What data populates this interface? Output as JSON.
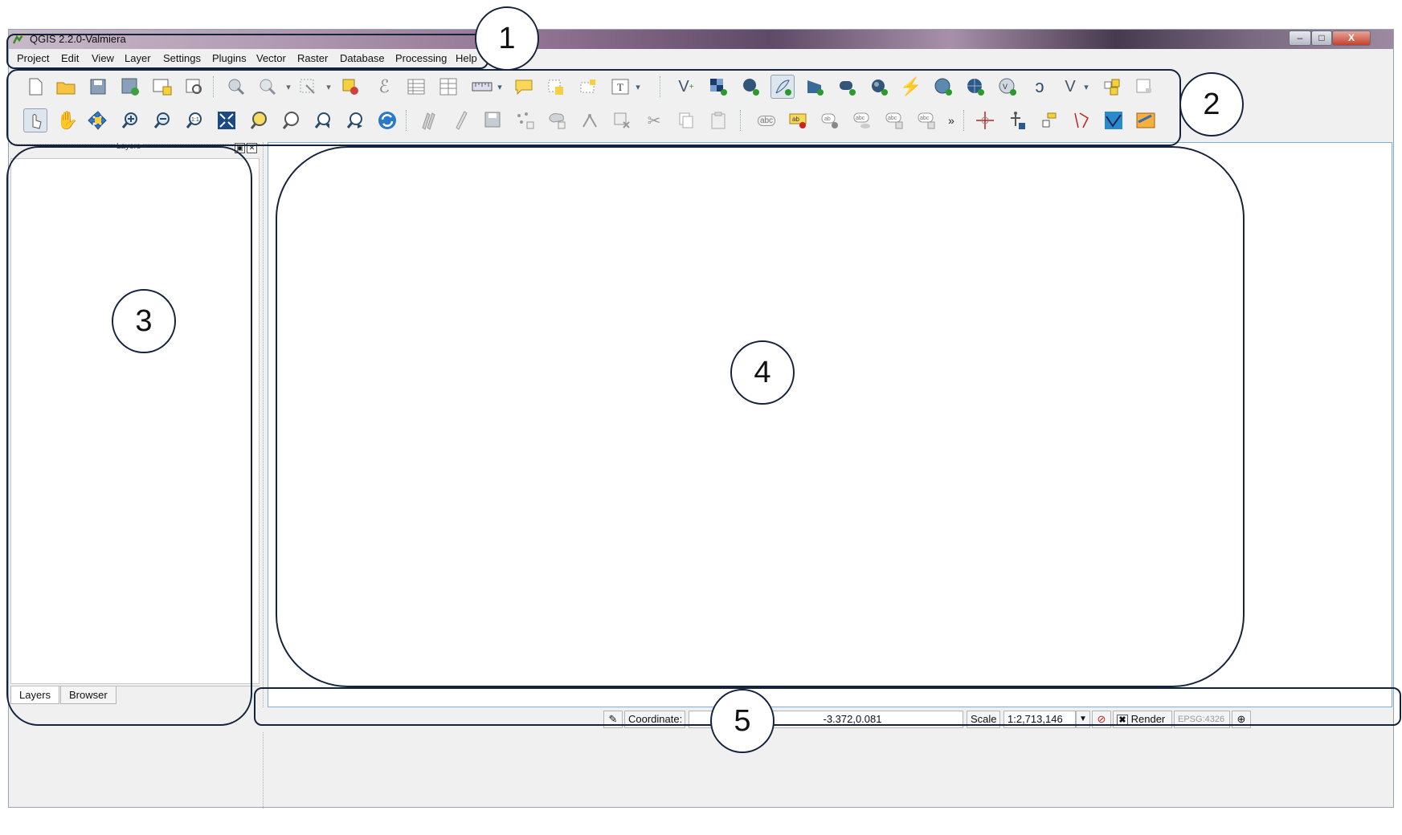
{
  "window": {
    "title": "QGIS 2.2.0-Valmiera",
    "controls": {
      "minimize": "–",
      "maximize": "□",
      "close": "X"
    }
  },
  "menubar": {
    "items": [
      "Project",
      "Edit",
      "View",
      "Layer",
      "Settings",
      "Plugins",
      "Vector",
      "Raster",
      "Database",
      "Processing",
      "Help"
    ]
  },
  "toolbar1": {
    "icons": [
      "new-project-icon",
      "open-project-icon",
      "save-project-icon",
      "save-as-icon",
      "new-print-composer-icon",
      "composer-manager-icon",
      "identify-icon",
      "select-icon",
      "select-dropdown-icon",
      "deselect-icon",
      "field-calculator-icon",
      "attribute-table-icon",
      "statistics-icon",
      "measure-icon",
      "annotation-icon",
      "text-annotation-icon",
      "form-annotation-icon",
      "text-tool-icon",
      "add-vector-layer-icon",
      "add-raster-layer-icon",
      "add-postgis-layer-icon",
      "add-spatialite-layer-icon",
      "add-mssql-layer-icon",
      "add-oracle-layer-icon",
      "add-delimited-text-icon",
      "add-wms-layer-icon",
      "add-wcs-layer-icon",
      "add-wfs-layer-icon",
      "new-shapefile-icon",
      "new-spatialite-icon",
      "new-gpx-icon",
      "add-virtual-layer-icon",
      "plugin-icon"
    ]
  },
  "toolbar2": {
    "icons": [
      "pan-touch-icon",
      "pan-icon",
      "pan-to-selection-icon",
      "zoom-in-icon",
      "zoom-out-icon",
      "zoom-native-icon",
      "zoom-full-icon",
      "zoom-to-layer-icon",
      "zoom-to-selection-icon",
      "zoom-last-icon",
      "zoom-next-icon",
      "refresh-icon",
      "current-edits-icon",
      "toggle-edit-icon",
      "save-edits-icon",
      "add-feature-icon",
      "move-feature-icon",
      "node-tool-icon",
      "delete-selected-icon",
      "cut-features-icon",
      "copy-features-icon",
      "paste-features-icon",
      "label-icon",
      "pin-labels-icon",
      "show-hide-labels-icon",
      "move-label-icon",
      "rotate-label-icon",
      "change-label-icon",
      "more-icon",
      "gps-icon",
      "geotag-icon",
      "georeferencer-icon",
      "road-graph-icon",
      "heatmap-icon",
      "coordinate-capture-icon"
    ]
  },
  "layers_panel": {
    "title": "Layers",
    "tabs": [
      "Layers",
      "Browser"
    ],
    "active_tab": "Layers"
  },
  "statusbar": {
    "coordinate_label": "Coordinate:",
    "coordinate_value": "-3.372,0.081",
    "scale_label": "Scale",
    "scale_value": "1:2,713,146",
    "render_label": "Render",
    "render_checked": true,
    "crs": "EPSG:4326"
  },
  "annotations": {
    "labels": [
      "1",
      "2",
      "3",
      "4",
      "5"
    ]
  },
  "colors": {
    "annotation_stroke": "#15233d",
    "map_canvas_border": "#7aaedc",
    "window_bg": "#f0f0f0"
  }
}
